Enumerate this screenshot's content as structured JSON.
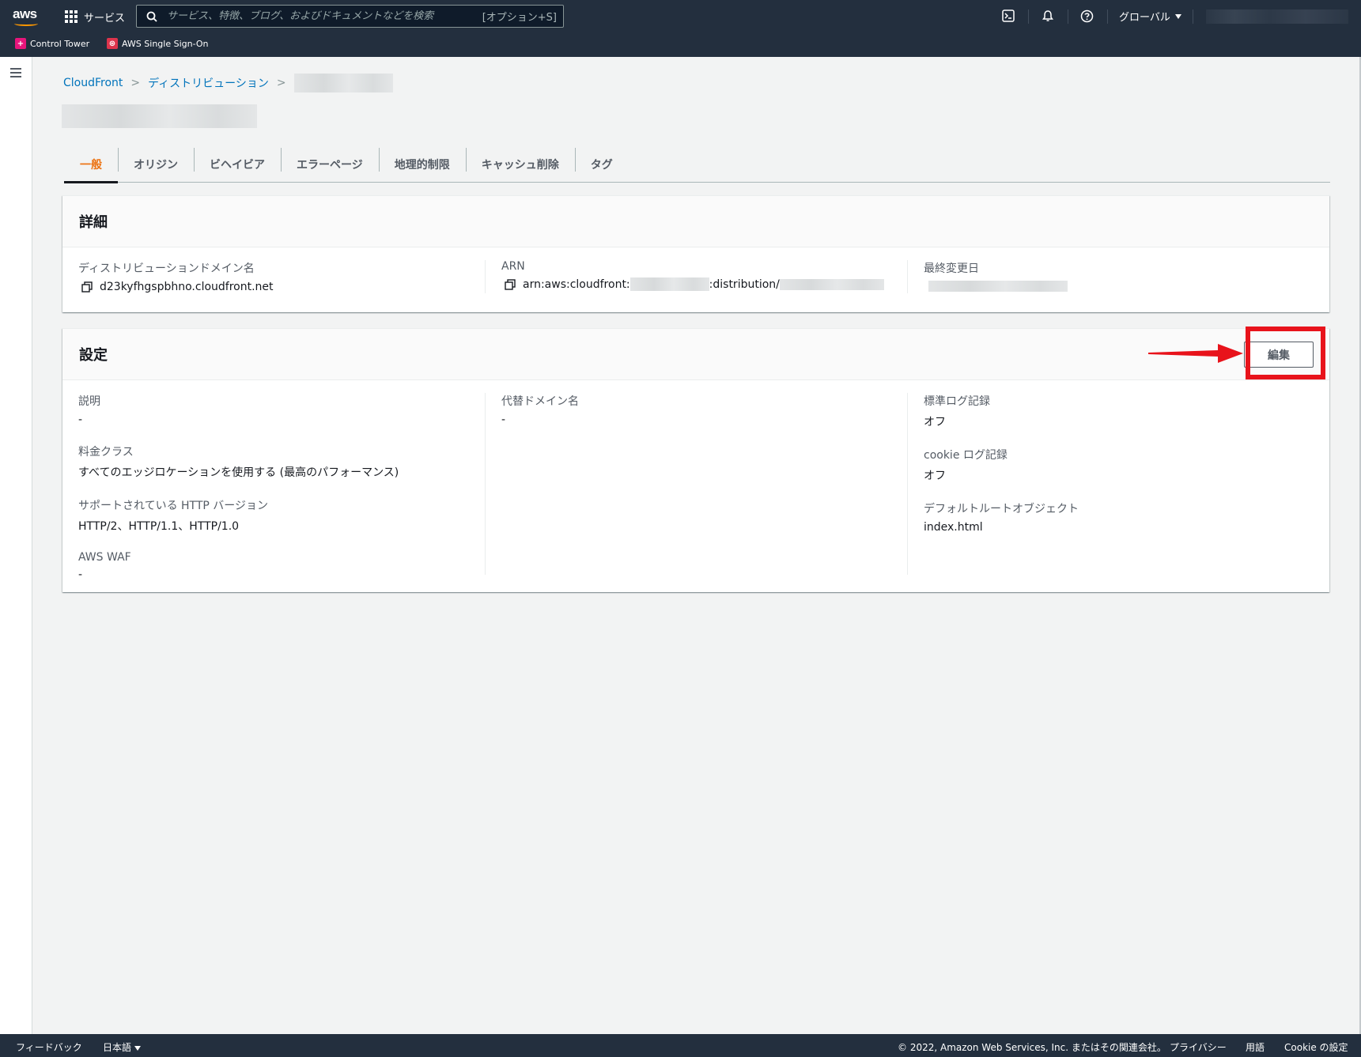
{
  "topnav": {
    "logo_text": "aws",
    "services_label": "サービス",
    "search_placeholder": "サービス、特徴、ブログ、およびドキュメントなどを検索",
    "search_shortcut": "[オプション+S]",
    "region_label": "グローバル",
    "favorites": [
      {
        "label": "Control Tower",
        "icon": "control-tower-icon",
        "color": "#e7157b"
      },
      {
        "label": "AWS Single Sign-On",
        "icon": "sso-icon",
        "color": "#dd344c"
      }
    ]
  },
  "breadcrumb": {
    "items": [
      "CloudFront",
      "ディストリビューション"
    ]
  },
  "tabs": [
    {
      "label": "一般",
      "active": true
    },
    {
      "label": "オリジン",
      "active": false
    },
    {
      "label": "ビヘイビア",
      "active": false
    },
    {
      "label": "エラーページ",
      "active": false
    },
    {
      "label": "地理的制限",
      "active": false
    },
    {
      "label": "キャッシュ削除",
      "active": false
    },
    {
      "label": "タグ",
      "active": false
    }
  ],
  "details": {
    "title": "詳細",
    "domain_label": "ディストリビューションドメイン名",
    "domain_value": "d23kyfhgspbhno.cloudfront.net",
    "arn_label": "ARN",
    "arn_prefix": "arn:aws:cloudfront:",
    "arn_middle": ":distribution/",
    "last_modified_label": "最終変更日"
  },
  "settings": {
    "title": "設定",
    "edit_label": "編集",
    "description_label": "説明",
    "description_value": "-",
    "price_class_label": "料金クラス",
    "price_class_value": "すべてのエッジロケーションを使用する (最高のパフォーマンス)",
    "http_versions_label": "サポートされている HTTP バージョン",
    "http_versions_value": "HTTP/2、HTTP/1.1、HTTP/1.0",
    "waf_label": "AWS WAF",
    "waf_value": "-",
    "cname_label": "代替ドメイン名",
    "cname_value": "-",
    "std_logging_label": "標準ログ記録",
    "std_logging_value": "オフ",
    "cookie_logging_label": "cookie ログ記録",
    "cookie_logging_value": "オフ",
    "default_root_label": "デフォルトルートオブジェクト",
    "default_root_value": "index.html"
  },
  "footer": {
    "feedback": "フィードバック",
    "language": "日本語",
    "copyright": "© 2022, Amazon Web Services, Inc. またはその関連会社。",
    "privacy": "プライバシー",
    "terms": "用語",
    "cookie_settings": "Cookie の設定"
  },
  "colors": {
    "nav_bg": "#232f3e",
    "link": "#0073bb",
    "active_tab": "#ec7211",
    "annotation_red": "#e8131b"
  }
}
